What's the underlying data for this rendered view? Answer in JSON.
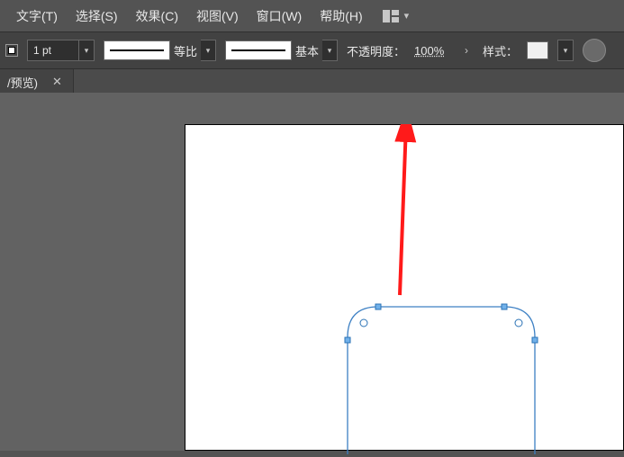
{
  "menu": {
    "items": [
      {
        "label": "文字(T)"
      },
      {
        "label": "选择(S)"
      },
      {
        "label": "效果(C)"
      },
      {
        "label": "视图(V)"
      },
      {
        "label": "窗口(W)"
      },
      {
        "label": "帮助(H)"
      }
    ]
  },
  "controlbar": {
    "stroke_weight": "1 pt",
    "profile_label": "等比",
    "brush_label": "基本",
    "opacity_label": "不透明度：",
    "opacity_value": "100%",
    "style_label": "样式："
  },
  "tab": {
    "title": "/预览)",
    "close_glyph": "✕"
  },
  "icons": {
    "chevron_down": "▾",
    "arrow_right": "›"
  }
}
